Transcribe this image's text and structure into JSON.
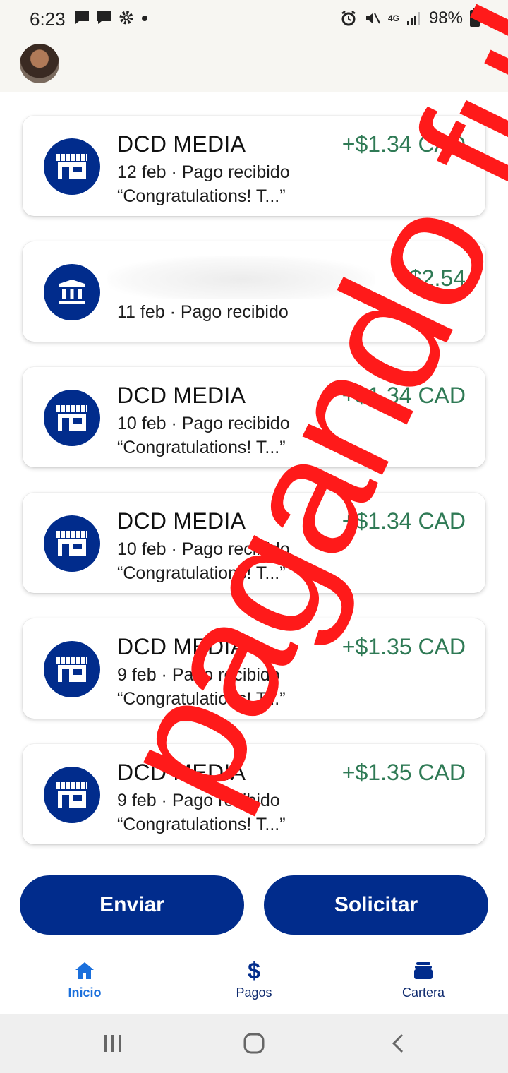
{
  "status_bar": {
    "time": "6:23",
    "battery": "98%",
    "network": "4G"
  },
  "transactions": [
    {
      "type": "store",
      "title": "DCD MEDIA",
      "date_status": "12 feb · Pago recibido",
      "note": "“Congratulations! T...”",
      "amount": "+$1.34 CAD"
    },
    {
      "type": "bank",
      "title": "",
      "date_status": "11 feb · Pago recibido",
      "note": "",
      "amount": "+$2.54"
    },
    {
      "type": "store",
      "title": "DCD MEDIA",
      "date_status": "10 feb · Pago recibido",
      "note": "“Congratulations! T...”",
      "amount": "+$1.34 CAD"
    },
    {
      "type": "store",
      "title": "DCD MEDIA",
      "date_status": "10 feb · Pago recibido",
      "note": "“Congratulations! T...”",
      "amount": "+$1.34 CAD"
    },
    {
      "type": "store",
      "title": "DCD MEDIA",
      "date_status": "9 feb · Pago recibido",
      "note": "“Congratulations! T...”",
      "amount": "+$1.35 CAD"
    },
    {
      "type": "store",
      "title": "DCD MEDIA",
      "date_status": "9 feb · Pago recibido",
      "note": "“Congratulations! T...”",
      "amount": "+$1.35 CAD"
    }
  ],
  "actions": {
    "send_label": "Enviar",
    "request_label": "Solicitar"
  },
  "bottom_nav": {
    "items": [
      {
        "label": "Inicio",
        "icon": "home-icon",
        "active": true
      },
      {
        "label": "Pagos",
        "icon": "dollar-icon",
        "active": false
      },
      {
        "label": "Cartera",
        "icon": "wallet-icon",
        "active": false
      }
    ]
  },
  "watermark": "pagando full",
  "colors": {
    "brand_navy": "#012c8c",
    "amount_green": "#2f7a55",
    "nav_active": "#1a6fdc",
    "watermark_red": "#ff1a1a"
  }
}
